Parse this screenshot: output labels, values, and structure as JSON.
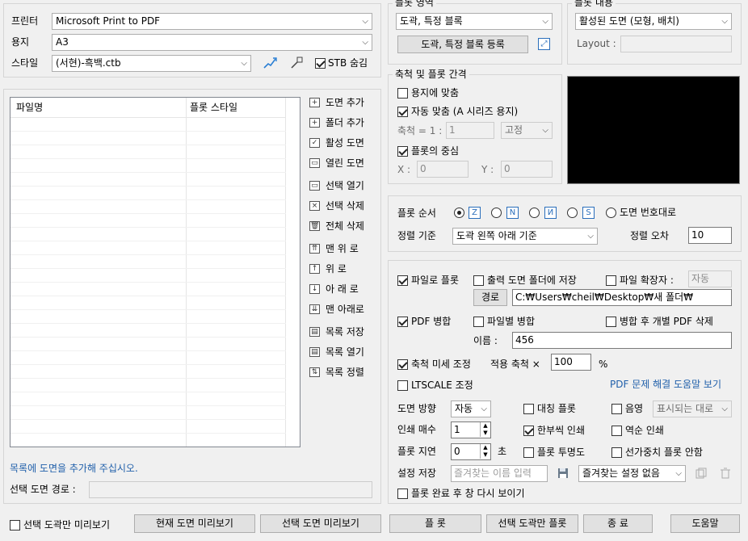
{
  "printer": {
    "label": "프린터",
    "value": "Microsoft Print to PDF"
  },
  "paper": {
    "label": "용지",
    "value": "A3"
  },
  "style": {
    "label": "스타일",
    "value": "(서현)-흑백.ctb",
    "stb_hide_label": "STB 숨김",
    "stb_hide_checked": true
  },
  "plot_area": {
    "title": "플롯 영역",
    "value": "도곽, 특정 블록",
    "register_button": "도곽, 특정 블록 등록"
  },
  "plot_content": {
    "title": "플롯 내용",
    "value": "활성된 도면 (모형, 배치)",
    "layout_label": "Layout :",
    "layout_value": ""
  },
  "scale": {
    "title": "축척 및 플롯 간격",
    "fit_paper": "용지에 맞춤",
    "fit_paper_checked": false,
    "auto_fit": "자동 맞춤 (A 시리즈 용지)",
    "auto_fit_checked": true,
    "ratio_label": "축척 = 1 :",
    "ratio_value": "1",
    "fixed_value": "고정",
    "center": "플롯의 중심",
    "center_checked": true,
    "x_label": "X :",
    "x_value": "0",
    "y_label": "Y :",
    "y_value": "0"
  },
  "file_list": {
    "col_file": "파일명",
    "col_style": "플롯 스타일",
    "hint": "목록에 도면을 추가해 주십시오.",
    "path_label": "선택 도면 경로 :",
    "path_value": ""
  },
  "side_buttons": [
    {
      "label": "도면 추가",
      "icon": "+"
    },
    {
      "label": "폴더 추가",
      "icon": "+"
    },
    {
      "label": "활성 도면",
      "icon": "✓"
    },
    {
      "label": "열린 도면",
      "icon": "▭"
    },
    {
      "label": "선택 열기",
      "icon": "▭"
    },
    {
      "label": "선택 삭제",
      "icon": "×"
    },
    {
      "label": "전체 삭제",
      "icon": "🗑"
    },
    {
      "label": "맨 위 로",
      "icon": "⇈"
    },
    {
      "label": "위     로",
      "icon": "↑"
    },
    {
      "label": "아 래 로",
      "icon": "↓"
    },
    {
      "label": "맨 아래로",
      "icon": "⇊"
    },
    {
      "label": "목록 저장",
      "icon": "▤"
    },
    {
      "label": "목록 열기",
      "icon": "▤"
    },
    {
      "label": "목록 정렬",
      "icon": "⇅"
    }
  ],
  "order": {
    "label": "플롯 순서",
    "selected_index": 0,
    "by_number": "도면 번호대로",
    "sort_label": "정렬 기준",
    "sort_value": "도곽 왼쪽 아래 기준",
    "tolerance_label": "정렬 오차",
    "tolerance_value": "10"
  },
  "output": {
    "plot_to_file": "파일로 플롯",
    "plot_to_file_checked": true,
    "save_in_folder": "출력 도면 폴더에 저장",
    "save_in_folder_checked": false,
    "file_ext": "파일 확장자 :",
    "file_ext_checked": false,
    "file_ext_value": "자동",
    "path_button": "경로",
    "path_value": "C:₩Users₩cheil₩Desktop₩새 폴더₩",
    "pdf_merge": "PDF 병합",
    "pdf_merge_checked": true,
    "merge_per_file": "파일별 병합",
    "merge_per_file_checked": false,
    "delete_after_merge": "병합 후 개별 PDF 삭제",
    "delete_after_merge_checked": false,
    "name_label": "이름 :",
    "name_value": "456",
    "fine_scale": "축척 미세 조정",
    "fine_scale_checked": true,
    "apply_scale_label": "적용 축척 ×",
    "apply_scale_value": "100",
    "percent": "%",
    "ltscale": "LTSCALE 조정",
    "ltscale_checked": false,
    "pdf_help": "PDF 문제 해결 도움말 보기",
    "orientation_label": "도면 방향",
    "orientation_value": "자동",
    "mirror": "대칭 플롯",
    "mirror_checked": false,
    "shade": "음영",
    "shade_checked": false,
    "shade_value": "표시되는 대로",
    "copies_label": "인쇄 매수",
    "copies_value": "1",
    "one_each": "한부씩 인쇄",
    "one_each_checked": true,
    "reverse": "역순 인쇄",
    "reverse_checked": false,
    "delay_label": "플롯 지연",
    "delay_value": "0",
    "delay_unit": "초",
    "transparency": "플롯 투명도",
    "transparency_checked": false,
    "no_lineweight": "선가중치 플롯 안함",
    "no_lineweight_checked": false,
    "preset_label": "설정 저장",
    "preset_placeholder": "즐겨찾는 이름 입력",
    "preset_select": "즐겨찾는 설정 없음",
    "reshow": "플롯 완료 후 창 다시 보이기",
    "reshow_checked": false
  },
  "footer": {
    "preview_selected_only": "선택 도곽만 미리보기",
    "preview_selected_only_checked": false,
    "preview_current": "현재 도면 미리보기",
    "preview_selected": "선택 도면 미리보기",
    "plot": "플 롯",
    "plot_selected_frame": "선택 도곽만 플롯",
    "exit": "종 료",
    "help": "도움말"
  }
}
